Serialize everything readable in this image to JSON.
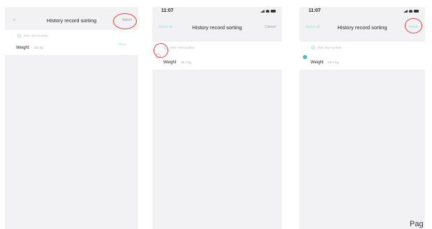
{
  "screens": [
    {
      "nav": {
        "back": "<",
        "title": "History record sorting",
        "right": "Select"
      },
      "record": {
        "id": "PEK-INV-012020",
        "weight_label": "Weight",
        "weight_value": "121 kg",
        "action": "Share"
      }
    },
    {
      "status": {
        "time": "11:07"
      },
      "nav": {
        "left": "Select all",
        "title": "History record sorting",
        "right": "Cancel"
      },
      "record": {
        "id": "PEK-INV-012020",
        "weight_label": "Weight",
        "weight_value": "50.7 kg"
      }
    },
    {
      "status": {
        "time": "11:07"
      },
      "nav": {
        "left": "Select all",
        "title": "History record sorting",
        "right": "Delete"
      },
      "record": {
        "id": "PEK-INV-012020",
        "weight_label": "Weight",
        "weight_value": "50.7 kg",
        "selected": true
      }
    }
  ],
  "footer": {
    "page_label": "Pag"
  },
  "colors": {
    "accent": "#9be3e3",
    "check": "#4dbfb2",
    "highlight_ring": "#d94343",
    "screen_bg": "#f2f2f5"
  }
}
